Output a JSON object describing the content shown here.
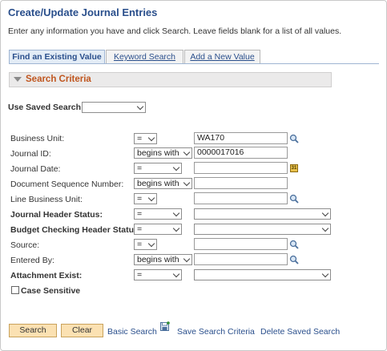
{
  "page": {
    "title": "Create/Update Journal Entries",
    "instructions": "Enter any information you have and click Search. Leave fields blank for a list of all values."
  },
  "tabs": [
    {
      "label": "Find an Existing Value",
      "active": true
    },
    {
      "label": "Keyword Search",
      "active": false
    },
    {
      "label": "Add a New Value",
      "active": false
    }
  ],
  "section": {
    "title": "Search Criteria"
  },
  "saved_search": {
    "label": "Use Saved Search:",
    "value": ""
  },
  "fields": [
    {
      "label": "Business Unit:",
      "operator": "=",
      "value": "WA170",
      "lookup": "search-icon",
      "bold": false
    },
    {
      "label": "Journal ID:",
      "operator": "begins with",
      "value": "0000017016",
      "lookup": "",
      "bold": false
    },
    {
      "label": "Journal Date:",
      "operator": "=",
      "value": "",
      "lookup": "calendar-icon",
      "bold": false
    },
    {
      "label": "Document Sequence Number:",
      "operator": "begins with",
      "value": "",
      "lookup": "",
      "bold": false
    },
    {
      "label": "Line Business Unit:",
      "operator": "=",
      "value": "",
      "lookup": "search-icon",
      "bold": false
    },
    {
      "label": "Journal Header Status:",
      "operator": "=",
      "value": "",
      "lookup": "",
      "bold": true
    },
    {
      "label": "Budget Checking Header Status:",
      "operator": "=",
      "value": "",
      "lookup": "",
      "bold": true
    },
    {
      "label": "Source:",
      "operator": "=",
      "value": "",
      "lookup": "search-icon",
      "bold": false
    },
    {
      "label": "Entered By:",
      "operator": "begins with",
      "value": "",
      "lookup": "search-icon",
      "bold": false
    },
    {
      "label": "Attachment Exist:",
      "operator": "=",
      "value": "",
      "lookup": "",
      "bold": true
    }
  ],
  "case_sensitive": {
    "label": "Case Sensitive",
    "checked": false
  },
  "buttons": {
    "search": "Search",
    "clear": "Clear"
  },
  "links": {
    "basic_search": "Basic Search",
    "save_search": "Save Search Criteria",
    "delete_saved": "Delete Saved Search"
  },
  "colors": {
    "title": "#2a4f8c",
    "section_title": "#c0561f",
    "button_bg": "#fbe1b2",
    "link": "#2a4f8c"
  }
}
